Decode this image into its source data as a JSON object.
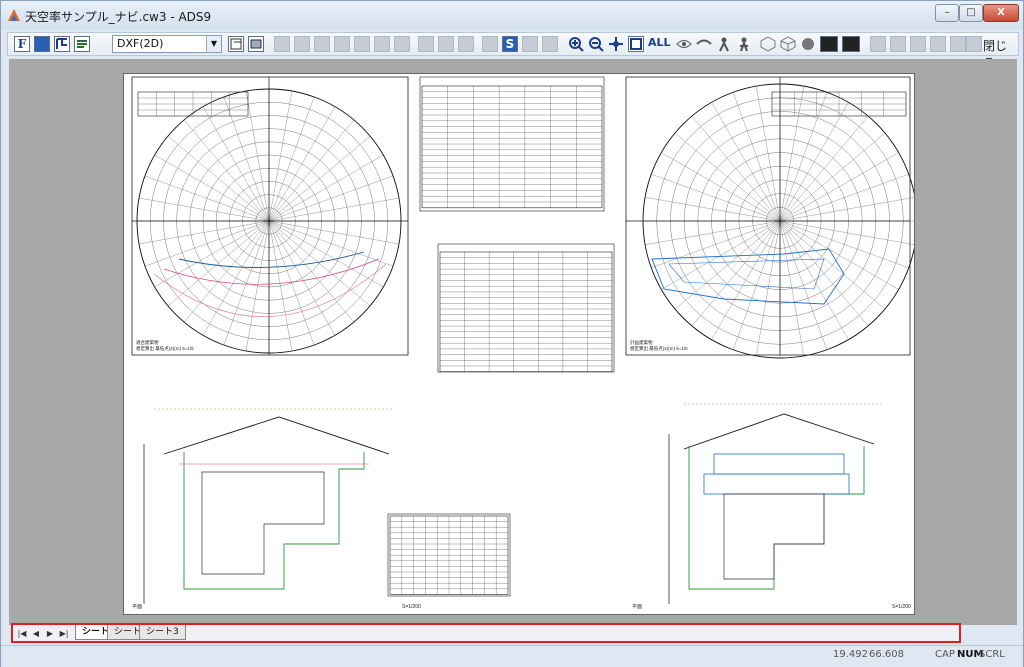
{
  "window": {
    "title": "天空率サンプル_ナビ.cw3 - ADS9",
    "buttons": {
      "minimize": "–",
      "maximize": "□",
      "close": "X"
    }
  },
  "toolbar": {
    "icons": [
      "font-F",
      "bold-F",
      "plan-tool",
      "layer-tool",
      "layout-tool",
      "print-setup"
    ],
    "format_select": "DXF(2D)",
    "zoom_all": "ALL",
    "close_label": "閉じる"
  },
  "sheet": {
    "left_section_label": "平面",
    "right_section_label": "平面",
    "left_scale": "S=1/200",
    "right_scale": "S=1/200",
    "left_caption": "適合建築物\n想定算出 最低点(2)(m) 5=1/5",
    "right_caption": "計画建築物\n想定算出 最低点(2)(m) 5=1/5"
  },
  "tabs": {
    "nav": [
      "|◀",
      "◀",
      "▶",
      "▶|"
    ],
    "items": [
      "シート1",
      "シート2",
      "シート3"
    ],
    "active_index": 0
  },
  "status": {
    "x": "19.492",
    "y": "66.608",
    "cap": "CAP",
    "num": "NUM",
    "scrl": "SCRL"
  }
}
